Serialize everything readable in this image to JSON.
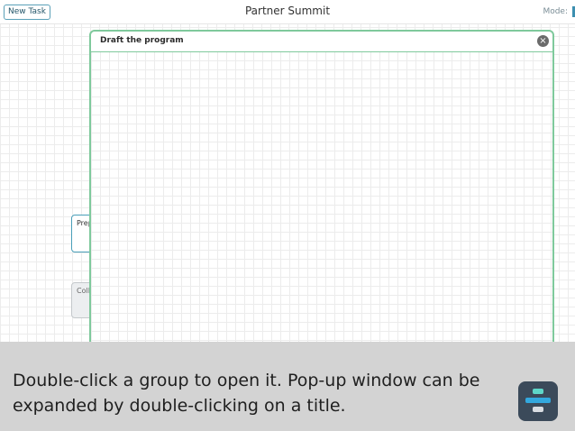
{
  "topbar": {
    "new_task_label": "New Task",
    "title": "Partner Summit",
    "mode_label": "Mode:"
  },
  "nodes": {
    "prep_label": "Prep",
    "coll_label": "Coll"
  },
  "popup": {
    "title": "Draft the program",
    "close_glyph": "×"
  },
  "caption": {
    "text": "Double-click a group to open it. Pop-up window can be expanded by double-clicking on a title."
  },
  "colors": {
    "popup_border": "#7fc99c",
    "accent": "#4a9fb9",
    "caption_bg": "#d3d3d3"
  }
}
